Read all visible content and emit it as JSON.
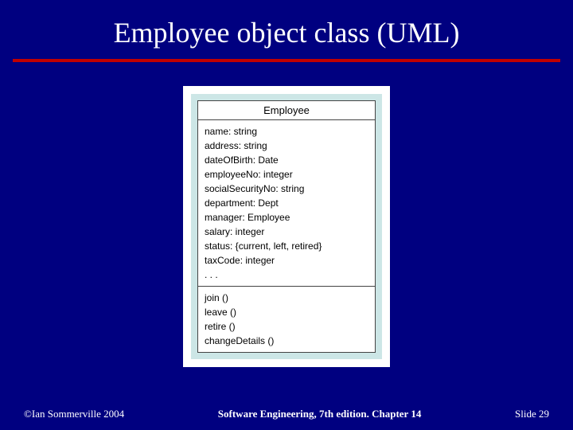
{
  "slide": {
    "title": "Employee object class (UML)"
  },
  "uml": {
    "class_name": "Employee",
    "attributes": [
      "name: string",
      "address: string",
      "dateOfBirth: Date",
      "employeeNo: integer",
      "socialSecurityNo: string",
      "department: Dept",
      "manager: Employee",
      "salary: integer",
      "status: {current, left, retired}",
      "taxCode: integer",
      ". . ."
    ],
    "methods": [
      "join ()",
      "leave ()",
      "retire ()",
      "changeDetails ()"
    ]
  },
  "footer": {
    "copyright": "©Ian Sommerville 2004",
    "center": "Software Engineering, 7th edition. Chapter 14",
    "slide_label": "Slide",
    "slide_number": "29"
  }
}
